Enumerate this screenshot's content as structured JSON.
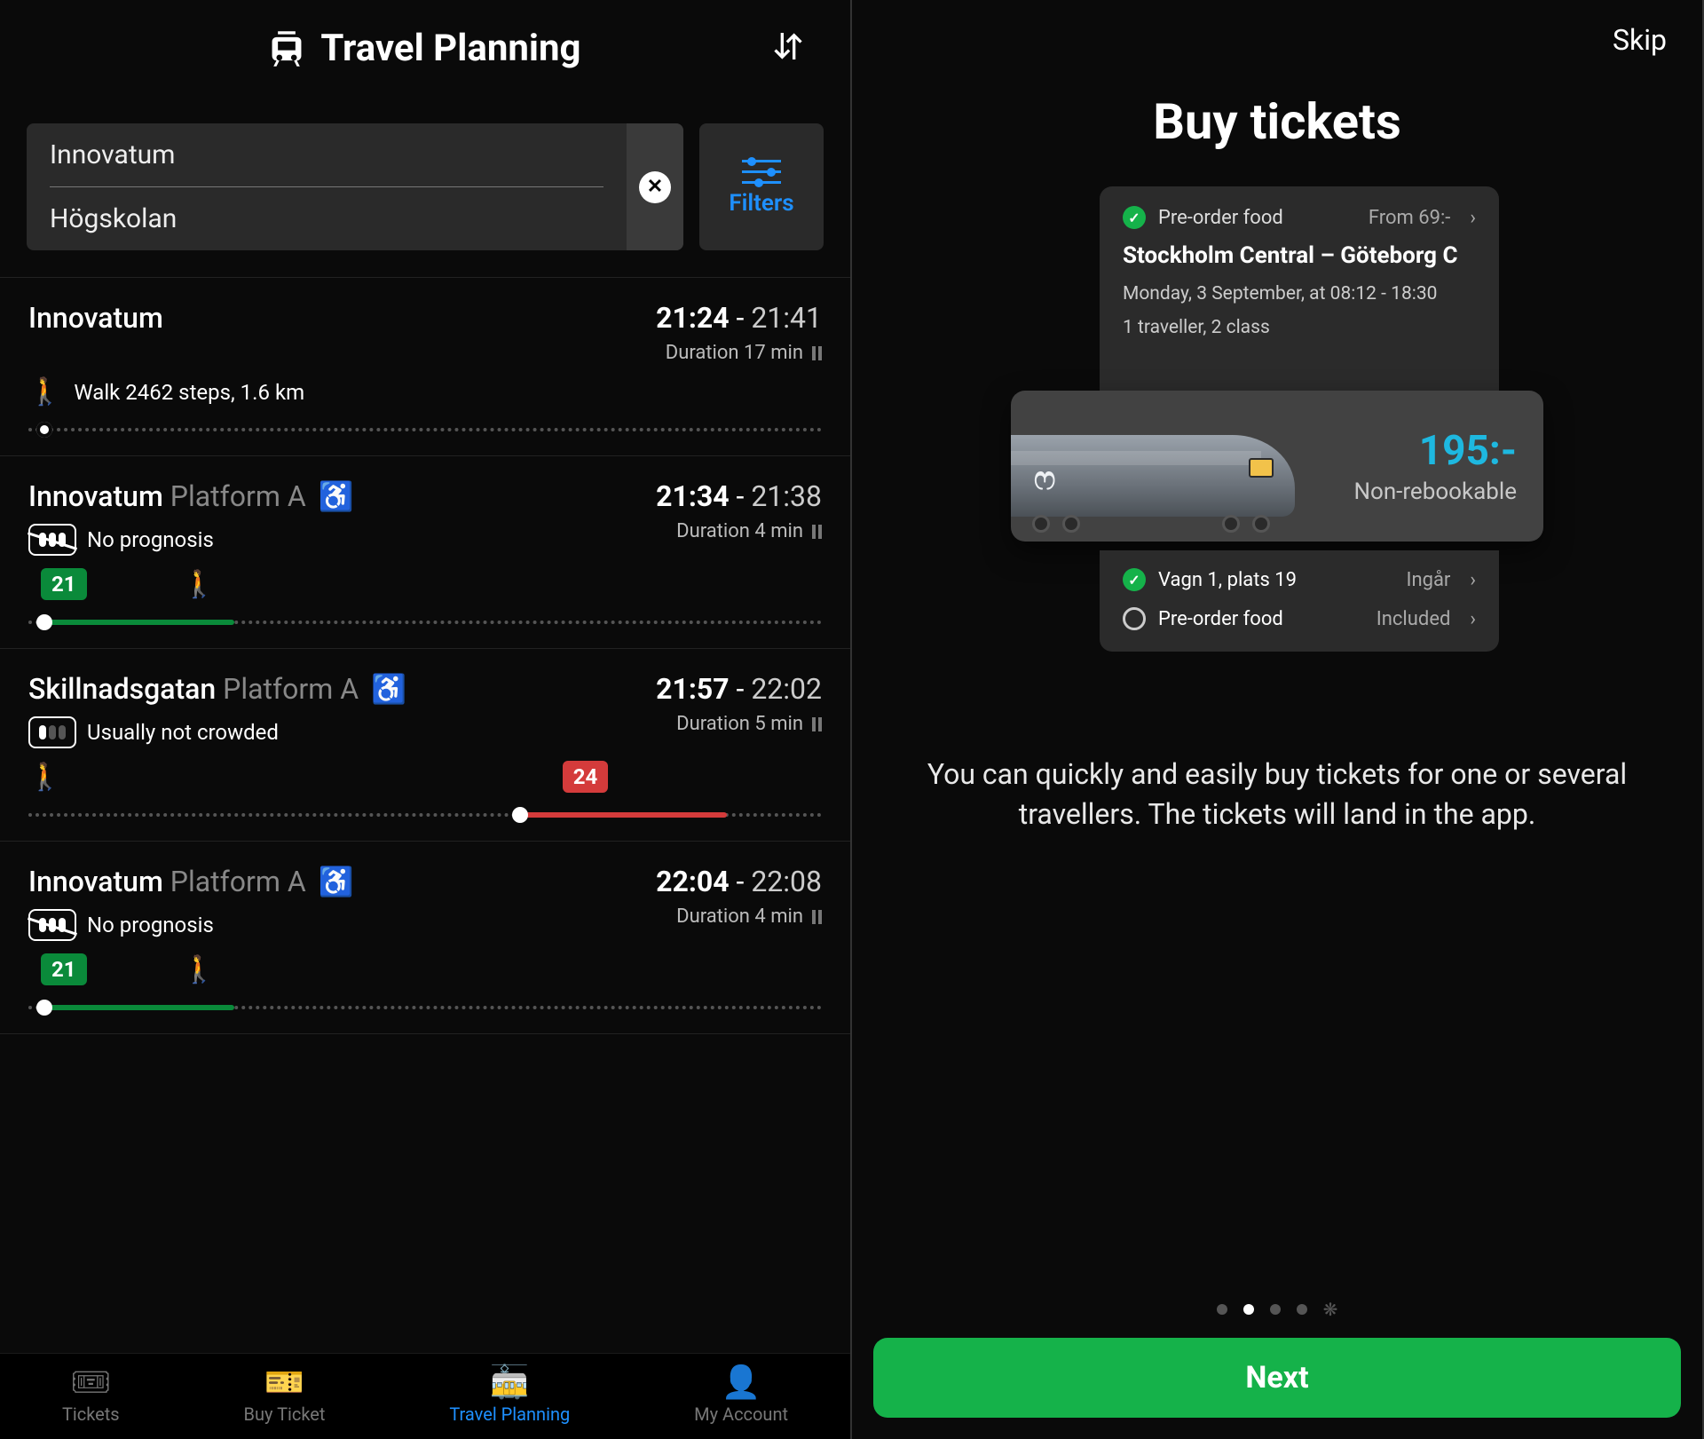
{
  "left": {
    "title": "Travel Planning",
    "search": {
      "from": "Innovatum",
      "to": "Högskolan"
    },
    "filters_label": "Filters",
    "trips": [
      {
        "location": "Innovatum",
        "platform": "",
        "accessible": false,
        "crowd_icon": "none",
        "crowd_text": "",
        "dep": "21:24",
        "arr": "21:41",
        "duration": "Duration 17 min",
        "mode_text": "Walk 2462 steps, 1.6 km",
        "line_badge": "",
        "line_color": "",
        "seg_start_pct": 0,
        "seg_end_pct": 0,
        "badge_left_pct": 0,
        "show_walk_after_badge": false,
        "dot_pct": 2
      },
      {
        "location": "Innovatum",
        "platform": "Platform A",
        "accessible": true,
        "crowd_icon": "strike",
        "crowd_text": "No prognosis",
        "dep": "21:34",
        "arr": "21:38",
        "duration": "Duration 4 min",
        "mode_text": "",
        "line_badge": "21",
        "line_color": "green",
        "seg_start_pct": 2,
        "seg_end_pct": 26,
        "badge_left_pct": 0,
        "show_walk_after_badge": true,
        "dot_pct": 2
      },
      {
        "location": "Skillnadsgatan",
        "platform": "Platform A",
        "accessible": true,
        "crowd_icon": "one",
        "crowd_text": "Usually not crowded",
        "dep": "21:57",
        "arr": "22:02",
        "duration": "Duration 5 min",
        "mode_text": "",
        "line_badge": "24",
        "line_color": "red",
        "seg_start_pct": 62,
        "seg_end_pct": 88,
        "badge_left_pct": 60,
        "show_walk_after_badge": false,
        "show_walk_before_badge": true,
        "dot_pct": 62
      },
      {
        "location": "Innovatum",
        "platform": "Platform A",
        "accessible": true,
        "crowd_icon": "strike",
        "crowd_text": "No prognosis",
        "dep": "22:04",
        "arr": "22:08",
        "duration": "Duration 4 min",
        "mode_text": "",
        "line_badge": "21",
        "line_color": "green",
        "seg_start_pct": 2,
        "seg_end_pct": 26,
        "badge_left_pct": 0,
        "show_walk_after_badge": true,
        "dot_pct": 2
      }
    ],
    "bottom_nav": [
      {
        "label": "Tickets",
        "active": false
      },
      {
        "label": "Buy Ticket",
        "active": false
      },
      {
        "label": "Travel Planning",
        "active": true
      },
      {
        "label": "My Account",
        "active": false
      }
    ]
  },
  "right": {
    "skip": "Skip",
    "title": "Buy tickets",
    "preorder_label": "Pre-order food",
    "preorder_price": "From 69:-",
    "route": "Stockholm Central – Göteborg C",
    "date_line": "Monday, 3 September, at 08:12 - 18:30",
    "traveller_line": "1 traveller, 2 class",
    "price": "195:-",
    "price_note": "Non-rebookable",
    "seat_label": "Vagn 1, plats 19",
    "seat_suffix": "Ingår",
    "food2_label": "Pre-order food",
    "food2_suffix": "Included",
    "onboard": "You can quickly and easily buy tickets for one or several travellers. The tickets will land in the app.",
    "next": "Next",
    "page_index": 1,
    "page_count": 4
  }
}
